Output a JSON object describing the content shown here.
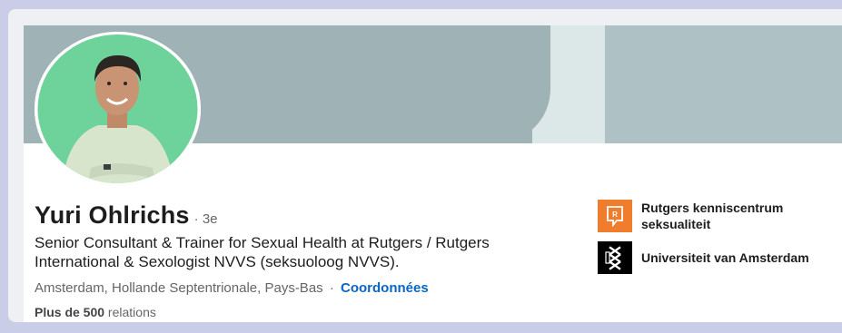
{
  "profile": {
    "name": "Yuri Ohlrichs",
    "degree": "· 3e",
    "headline": "Senior Consultant & Trainer for Sexual Health at Rutgers / Rutgers International & Sexologist NVVS (seksuoloog NVVS).",
    "location": "Amsterdam, Hollande Septentrionale, Pays-Bas",
    "separator": "·",
    "contact_label": "Coordonnées",
    "connections_bold": "Plus de 500",
    "connections_rest": " relations"
  },
  "orgs": [
    {
      "label_line1": "Rutgers kenniscentrum",
      "label_line2": "seksualiteit",
      "icon": "rutgers-logo-icon",
      "color": "#f07d2d"
    },
    {
      "label_line1": "Universiteit van Amsterdam",
      "label_line2": "",
      "icon": "uva-logo-icon",
      "color": "#000000"
    }
  ],
  "colors": {
    "accent": "#0a66c2",
    "banner": "#9fb3b7",
    "avatar_bg": "#6ed39a"
  }
}
